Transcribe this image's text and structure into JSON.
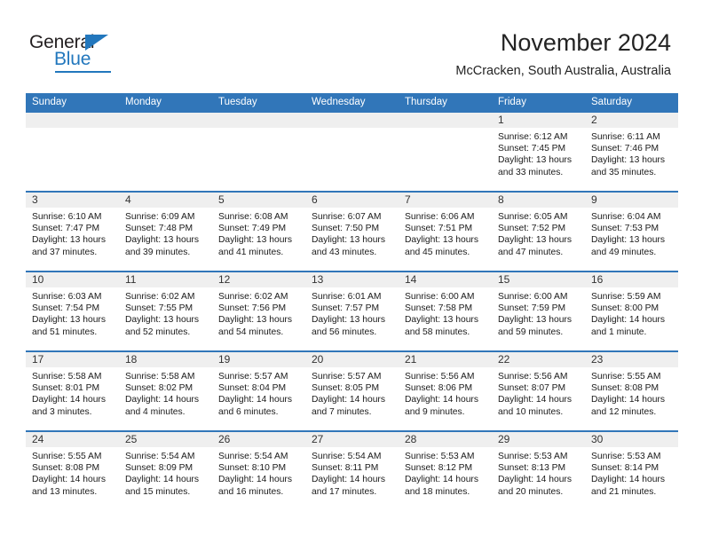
{
  "brand": {
    "name_part1": "General",
    "name_part2": "Blue",
    "accent_color": "#2277bd"
  },
  "header": {
    "title": "November 2024",
    "location": "McCracken, South Australia, Australia"
  },
  "theme": {
    "header_blue": "#3176b9",
    "daynum_band": "#efefef",
    "text": "#1a1a1a"
  },
  "weekdays": [
    "Sunday",
    "Monday",
    "Tuesday",
    "Wednesday",
    "Thursday",
    "Friday",
    "Saturday"
  ],
  "labels": {
    "sunrise": "Sunrise:",
    "sunset": "Sunset:",
    "daylight": "Daylight:"
  },
  "weeks": [
    [
      {
        "day": "",
        "sunrise": "",
        "sunset": "",
        "daylight_line1": "",
        "daylight_line2": ""
      },
      {
        "day": "",
        "sunrise": "",
        "sunset": "",
        "daylight_line1": "",
        "daylight_line2": ""
      },
      {
        "day": "",
        "sunrise": "",
        "sunset": "",
        "daylight_line1": "",
        "daylight_line2": ""
      },
      {
        "day": "",
        "sunrise": "",
        "sunset": "",
        "daylight_line1": "",
        "daylight_line2": ""
      },
      {
        "day": "",
        "sunrise": "",
        "sunset": "",
        "daylight_line1": "",
        "daylight_line2": ""
      },
      {
        "day": "1",
        "sunrise": "Sunrise: 6:12 AM",
        "sunset": "Sunset: 7:45 PM",
        "daylight_line1": "Daylight: 13 hours",
        "daylight_line2": "and 33 minutes."
      },
      {
        "day": "2",
        "sunrise": "Sunrise: 6:11 AM",
        "sunset": "Sunset: 7:46 PM",
        "daylight_line1": "Daylight: 13 hours",
        "daylight_line2": "and 35 minutes."
      }
    ],
    [
      {
        "day": "3",
        "sunrise": "Sunrise: 6:10 AM",
        "sunset": "Sunset: 7:47 PM",
        "daylight_line1": "Daylight: 13 hours",
        "daylight_line2": "and 37 minutes."
      },
      {
        "day": "4",
        "sunrise": "Sunrise: 6:09 AM",
        "sunset": "Sunset: 7:48 PM",
        "daylight_line1": "Daylight: 13 hours",
        "daylight_line2": "and 39 minutes."
      },
      {
        "day": "5",
        "sunrise": "Sunrise: 6:08 AM",
        "sunset": "Sunset: 7:49 PM",
        "daylight_line1": "Daylight: 13 hours",
        "daylight_line2": "and 41 minutes."
      },
      {
        "day": "6",
        "sunrise": "Sunrise: 6:07 AM",
        "sunset": "Sunset: 7:50 PM",
        "daylight_line1": "Daylight: 13 hours",
        "daylight_line2": "and 43 minutes."
      },
      {
        "day": "7",
        "sunrise": "Sunrise: 6:06 AM",
        "sunset": "Sunset: 7:51 PM",
        "daylight_line1": "Daylight: 13 hours",
        "daylight_line2": "and 45 minutes."
      },
      {
        "day": "8",
        "sunrise": "Sunrise: 6:05 AM",
        "sunset": "Sunset: 7:52 PM",
        "daylight_line1": "Daylight: 13 hours",
        "daylight_line2": "and 47 minutes."
      },
      {
        "day": "9",
        "sunrise": "Sunrise: 6:04 AM",
        "sunset": "Sunset: 7:53 PM",
        "daylight_line1": "Daylight: 13 hours",
        "daylight_line2": "and 49 minutes."
      }
    ],
    [
      {
        "day": "10",
        "sunrise": "Sunrise: 6:03 AM",
        "sunset": "Sunset: 7:54 PM",
        "daylight_line1": "Daylight: 13 hours",
        "daylight_line2": "and 51 minutes."
      },
      {
        "day": "11",
        "sunrise": "Sunrise: 6:02 AM",
        "sunset": "Sunset: 7:55 PM",
        "daylight_line1": "Daylight: 13 hours",
        "daylight_line2": "and 52 minutes."
      },
      {
        "day": "12",
        "sunrise": "Sunrise: 6:02 AM",
        "sunset": "Sunset: 7:56 PM",
        "daylight_line1": "Daylight: 13 hours",
        "daylight_line2": "and 54 minutes."
      },
      {
        "day": "13",
        "sunrise": "Sunrise: 6:01 AM",
        "sunset": "Sunset: 7:57 PM",
        "daylight_line1": "Daylight: 13 hours",
        "daylight_line2": "and 56 minutes."
      },
      {
        "day": "14",
        "sunrise": "Sunrise: 6:00 AM",
        "sunset": "Sunset: 7:58 PM",
        "daylight_line1": "Daylight: 13 hours",
        "daylight_line2": "and 58 minutes."
      },
      {
        "day": "15",
        "sunrise": "Sunrise: 6:00 AM",
        "sunset": "Sunset: 7:59 PM",
        "daylight_line1": "Daylight: 13 hours",
        "daylight_line2": "and 59 minutes."
      },
      {
        "day": "16",
        "sunrise": "Sunrise: 5:59 AM",
        "sunset": "Sunset: 8:00 PM",
        "daylight_line1": "Daylight: 14 hours",
        "daylight_line2": "and 1 minute."
      }
    ],
    [
      {
        "day": "17",
        "sunrise": "Sunrise: 5:58 AM",
        "sunset": "Sunset: 8:01 PM",
        "daylight_line1": "Daylight: 14 hours",
        "daylight_line2": "and 3 minutes."
      },
      {
        "day": "18",
        "sunrise": "Sunrise: 5:58 AM",
        "sunset": "Sunset: 8:02 PM",
        "daylight_line1": "Daylight: 14 hours",
        "daylight_line2": "and 4 minutes."
      },
      {
        "day": "19",
        "sunrise": "Sunrise: 5:57 AM",
        "sunset": "Sunset: 8:04 PM",
        "daylight_line1": "Daylight: 14 hours",
        "daylight_line2": "and 6 minutes."
      },
      {
        "day": "20",
        "sunrise": "Sunrise: 5:57 AM",
        "sunset": "Sunset: 8:05 PM",
        "daylight_line1": "Daylight: 14 hours",
        "daylight_line2": "and 7 minutes."
      },
      {
        "day": "21",
        "sunrise": "Sunrise: 5:56 AM",
        "sunset": "Sunset: 8:06 PM",
        "daylight_line1": "Daylight: 14 hours",
        "daylight_line2": "and 9 minutes."
      },
      {
        "day": "22",
        "sunrise": "Sunrise: 5:56 AM",
        "sunset": "Sunset: 8:07 PM",
        "daylight_line1": "Daylight: 14 hours",
        "daylight_line2": "and 10 minutes."
      },
      {
        "day": "23",
        "sunrise": "Sunrise: 5:55 AM",
        "sunset": "Sunset: 8:08 PM",
        "daylight_line1": "Daylight: 14 hours",
        "daylight_line2": "and 12 minutes."
      }
    ],
    [
      {
        "day": "24",
        "sunrise": "Sunrise: 5:55 AM",
        "sunset": "Sunset: 8:08 PM",
        "daylight_line1": "Daylight: 14 hours",
        "daylight_line2": "and 13 minutes."
      },
      {
        "day": "25",
        "sunrise": "Sunrise: 5:54 AM",
        "sunset": "Sunset: 8:09 PM",
        "daylight_line1": "Daylight: 14 hours",
        "daylight_line2": "and 15 minutes."
      },
      {
        "day": "26",
        "sunrise": "Sunrise: 5:54 AM",
        "sunset": "Sunset: 8:10 PM",
        "daylight_line1": "Daylight: 14 hours",
        "daylight_line2": "and 16 minutes."
      },
      {
        "day": "27",
        "sunrise": "Sunrise: 5:54 AM",
        "sunset": "Sunset: 8:11 PM",
        "daylight_line1": "Daylight: 14 hours",
        "daylight_line2": "and 17 minutes."
      },
      {
        "day": "28",
        "sunrise": "Sunrise: 5:53 AM",
        "sunset": "Sunset: 8:12 PM",
        "daylight_line1": "Daylight: 14 hours",
        "daylight_line2": "and 18 minutes."
      },
      {
        "day": "29",
        "sunrise": "Sunrise: 5:53 AM",
        "sunset": "Sunset: 8:13 PM",
        "daylight_line1": "Daylight: 14 hours",
        "daylight_line2": "and 20 minutes."
      },
      {
        "day": "30",
        "sunrise": "Sunrise: 5:53 AM",
        "sunset": "Sunset: 8:14 PM",
        "daylight_line1": "Daylight: 14 hours",
        "daylight_line2": "and 21 minutes."
      }
    ]
  ]
}
